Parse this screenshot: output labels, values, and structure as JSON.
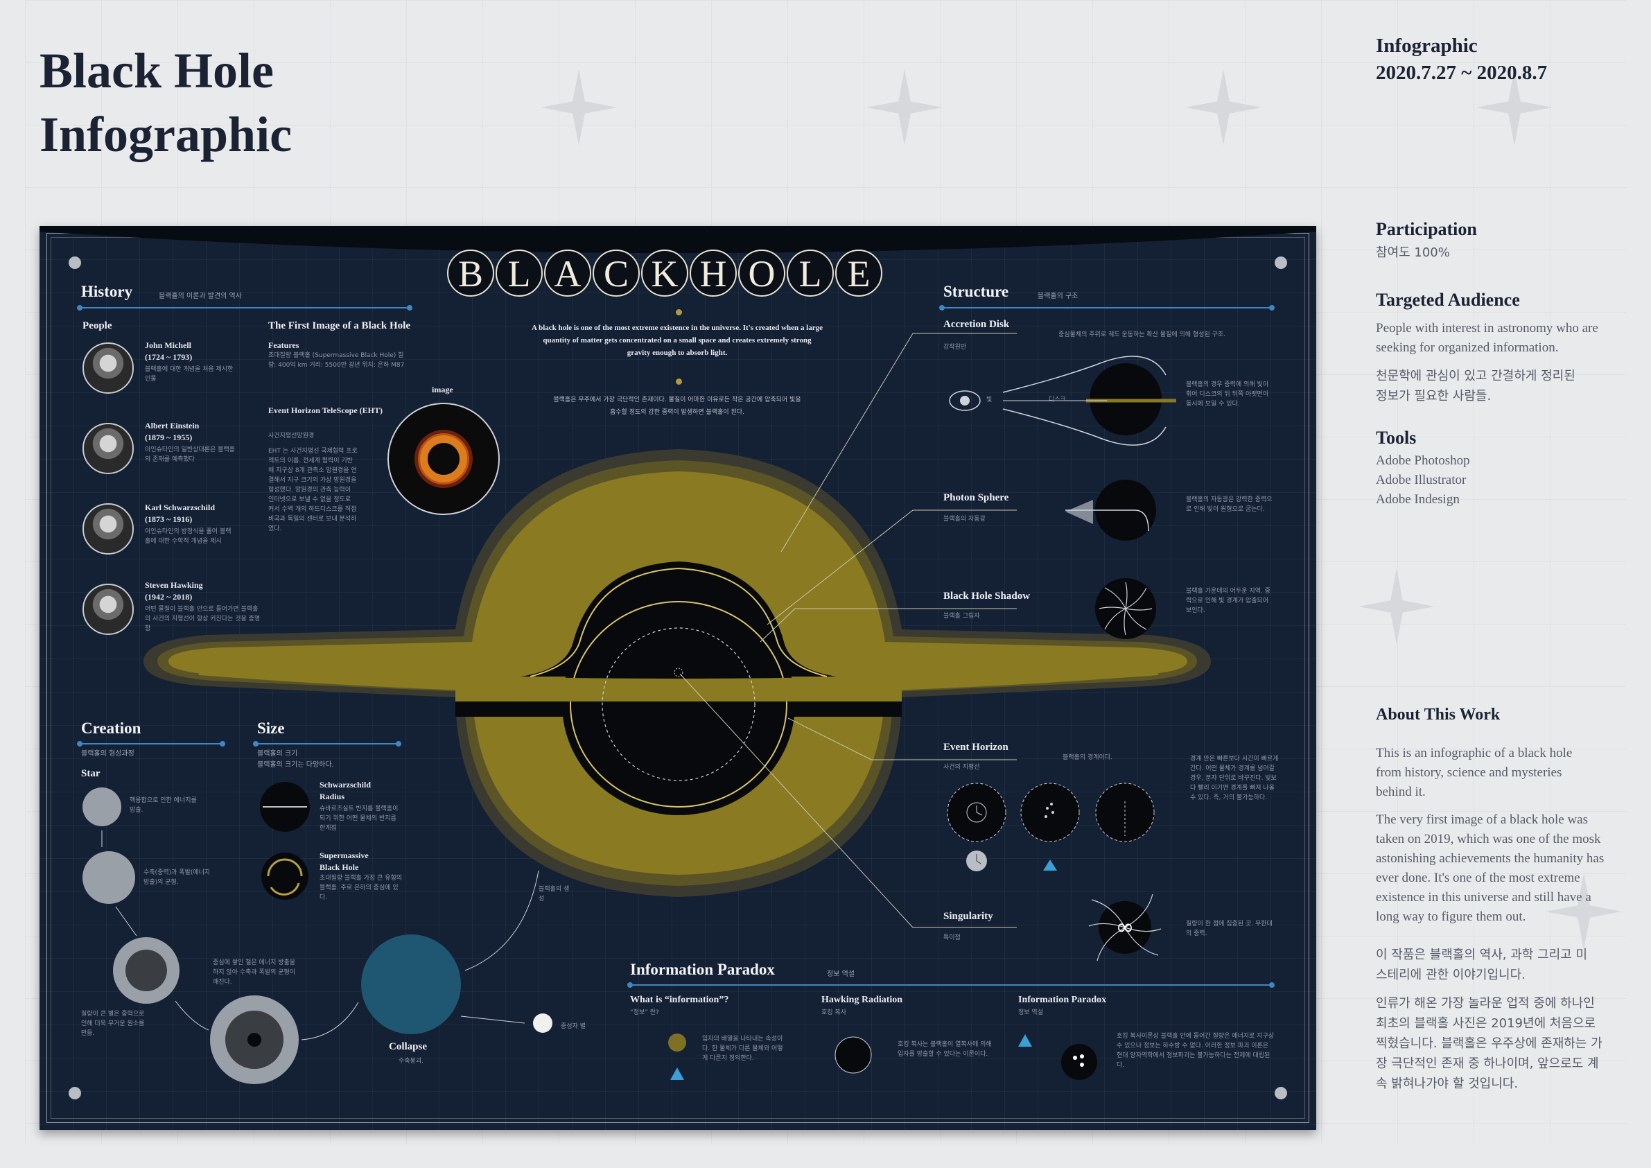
{
  "page": {
    "title_line1": "Black Hole",
    "title_line2": "Infographic"
  },
  "sidebar": {
    "category": "Infographic",
    "date": "2020.7.27 ~ 2020.8.7",
    "participation_title": "Participation",
    "participation_value": "참여도 100%",
    "audience_title": "Targeted Audience",
    "audience_en": "People with interest in astronomy who are seeking for organized information.",
    "audience_ko": "천문학에 관심이 있고 간결하게 정리된 정보가 필요한 사람들.",
    "tools_title": "Tools",
    "tools": [
      "Adobe Photoshop",
      "Adobe Illustrator",
      "Adobe Indesign"
    ],
    "about_title": "About This Work",
    "about_p1": "This is an infographic of a black hole from history, science and mysteries behind it.",
    "about_p2": "The very first image of a black hole was taken on 2019, which was one of the mosk astonishing achievements the humanity has ever done.  It's one of the most extreme existence in this universe and still have a long way to figure them out.",
    "about_ko1": "이 작품은 블랙홀의 역사, 과학 그리고 미스테리에 관한 이야기입니다.",
    "about_ko2": "인류가 해온 가장 놀라운 업적 중에 하나인 최초의 블랙홀 사진은 2019년에 처음으로 찍혔습니다.  블랙홀은 우주상에 존재하는 가장 극단적인 존재 중 하나이며, 앞으로도 계속 밝혀나가야 할 것입니다."
  },
  "poster": {
    "letters": [
      "B",
      "L",
      "A",
      "C",
      "K",
      "H",
      "O",
      "L",
      "E"
    ],
    "intro_en": "A black hole is one of the most extreme existence in the universe. It's created when a large quantity of matter gets concentrated on a small space and creates extremely strong gravity enough to absorb light.",
    "intro_ko": "블랙홀은 우주에서 가장 극단적인 존재이다. 물질이 어마한 이유로든 작은 공간에 압축되어 빛을 흡수할 정도의 강한 중력이 발생하면 블랙홀이 된다.",
    "history": {
      "title": "History",
      "sub": "블랙홀의 이론과 발견의 역사",
      "people_label": "People",
      "people": [
        {
          "name": "John Michell",
          "years": "(1724 ~ 1793)",
          "desc": "블랙홀에 대한 개념을 처음 제시한 인물"
        },
        {
          "name": "Albert Einstein",
          "years": "(1879 ~ 1955)",
          "desc": "아인슈타인의 일반상대론은 블랙홀의 존재를 예측했다"
        },
        {
          "name": "Karl Schwarzschild",
          "years": "(1873 ~ 1916)",
          "desc": "아인슈타인의 방정식을 풀어 블랙홀에 대한 수학적 개념을 제시"
        },
        {
          "name": "Steven Hawking",
          "years": "(1942 ~ 2018)",
          "desc": "어떤 물질이 블랙홀 안으로 들어가면 블랙홀의 사건의 지평선이 항상 커진다는 것을 증명함"
        }
      ],
      "first_image_title": "The First Image of a Black Hole",
      "features_label": "Features",
      "features_text": "초대질량 블랙홀 (Supermassive Black Hole) 질량: 400억 km 거리: 5500만 광년 위치: 은하 M87",
      "eht_label": "Event Horizon TeleScope (EHT)",
      "eht_sub": "사건지평선망원경",
      "eht_text": "EHT 는 사건지평선 국제협력 프로젝트의 이름. 전세계 협력이 기반해 지구상 8개 관측소 망원경을 연결해서 지구 크기의 가상 망원경을 형성했다. 망원경의 관측 능력이 인터넷으로 보낼 수 없을 정도로 커서 수백 개의 하드디스크를 직접 비국과 독일의 센터로 보내 분석하였다.",
      "image_label": "image"
    },
    "structure": {
      "title": "Structure",
      "sub": "블랙홀의 구조",
      "items": [
        {
          "name": "Accretion Disk",
          "ko": "강착원반",
          "desc": "중심물체의 주위로 궤도 운동하는 확산 물질에 의해 형성된 구조.",
          "side": "블랙홀의 경우 중력에 의해 빛이 휘어 디스크의 뒤 뒤쪽 아랫면이 동시에 보일 수 있다.",
          "eye_label": "빛",
          "disk_label": "디스크"
        },
        {
          "name": "Photon Sphere",
          "ko": "블랙홀의 자동광",
          "side": "블랙홀의 자동광은 강력한 중력으로 인해 빛이 원형으로 굽는다."
        },
        {
          "name": "Black Hole Shadow",
          "ko": "블랙홀 그림자",
          "side": "블랙홀 가운데의 어두운 지역. 중력으로 인해 빛 경계가 압출되어 보인다."
        },
        {
          "name": "Event Horizon",
          "ko": "사건의 지평선",
          "desc": "블랙홀의 경계이다.",
          "side": "경계 안은 빠른보다 시간이 빠르게 간다. 어떤 물체가 경계를 넘어갈 경우, 분자 단위로 바꾸진다. 빛보다 빨리 이기면 경계를 빠져 나올 수 있다. 즉, 거의 불가능하다."
        },
        {
          "name": "Singularity",
          "ko": "특이점",
          "side": "질량이 한 점에 집중된 곳. 무한대의 중력."
        }
      ]
    },
    "creation": {
      "title": "Creation",
      "sub": "블랙홀의 형성과정",
      "star_label": "Star",
      "star_desc": "핵융합으로 인한 에너지를 방출.",
      "stage2": "수축(중력)과 폭발(에너지 방출)의 균형.",
      "stage3": "질량이 큰 별은 중력으로 인해 더욱 무거운 원소를 만듦.",
      "stage4": "중심에 쌓인 철은 에너지 방출을 하지 않아 수축과 폭발의 균형이 깨진다.",
      "collapse": "Collapse",
      "collapse_ko": "수축붕괴.",
      "black_hole_ko": "블랙홀의 생성",
      "neutron_ko": "중성자 별"
    },
    "size": {
      "title": "Size",
      "sub": "블랙홀의 크기",
      "sub2": "블랙홀의 크기는 다양하다.",
      "items": [
        {
          "name": "Schwarzschild Radius",
          "desc": "슈바르츠실트 반지름 블랙홀이 되기 위한 어떤 물체의 반지름 한계점"
        },
        {
          "name": "Supermassive Black Hole",
          "desc": "초대질량 블랙홀 가장 큰 유형의 블랙홀. 주로 은하의 중심에 있다."
        }
      ]
    },
    "paradox": {
      "title": "Information Paradox",
      "sub": "정보 역설",
      "cols": [
        {
          "title": "What is “information”?",
          "ko": "“정보” 란?",
          "desc": "입자의 배열을 나타내는 속성이다. 한 물체가 다른 물체와 어떻게 다른지 정의한다."
        },
        {
          "title": "Hawking Radiation",
          "ko": "호킹 복사",
          "desc": "호킹 복사는 블랙홀이 열복사에 의해 입자를 방출할 수 있다는 이론이다."
        },
        {
          "title": "Information Paradox",
          "ko": "정보 역설",
          "desc": "호킹 복사이론상 블랙홀 안에 들어간 질량은 에너지로 지구상 수 있으나 정보는 하수방 수 없다. 이러한 정보 파괴 이론은 현대 양자역학에서 정보파괴는 불가능하다는 전제에 대립된다."
        }
      ]
    },
    "colors": {
      "navy": "#142034",
      "gold": "#8a7a22",
      "accent_blue": "#3f86c4",
      "light_blue": "#3aa0d8"
    }
  }
}
